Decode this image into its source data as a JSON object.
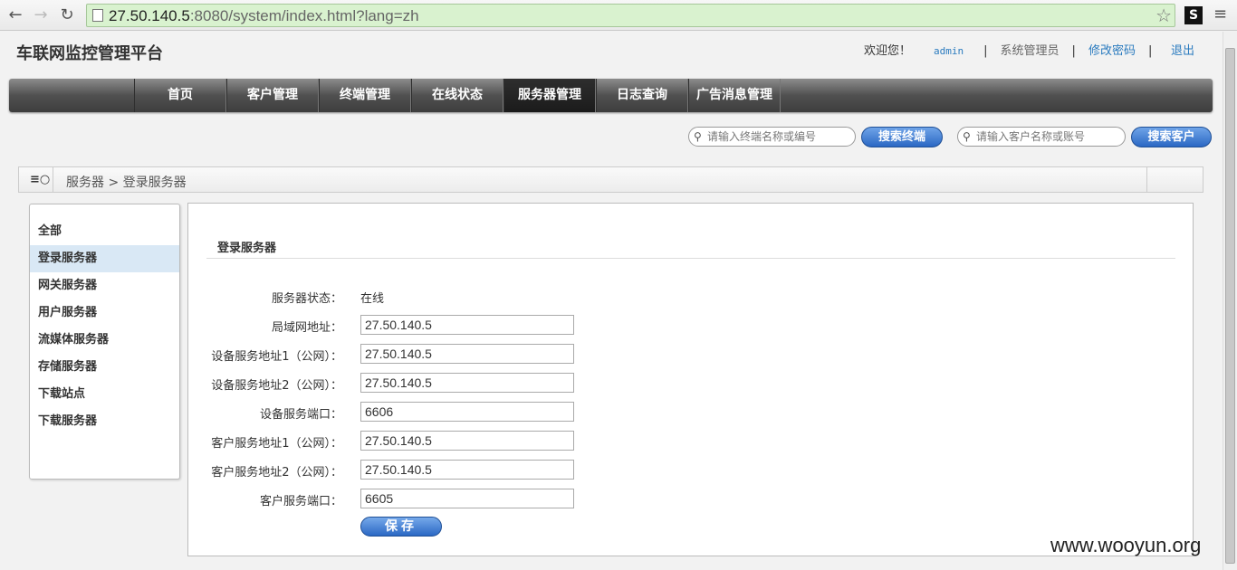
{
  "browser": {
    "url_host": "27.50.140.5",
    "url_rest": ":8080/system/index.html?lang=zh",
    "extension_label": "S"
  },
  "header": {
    "brand": "车联网监控管理平台",
    "welcome": "欢迎您！",
    "username": "admin",
    "sep": "|",
    "role": "系统管理员",
    "change_password": "修改密码",
    "logout": "退出"
  },
  "nav": {
    "tabs": [
      {
        "label": "首页"
      },
      {
        "label": "客户管理"
      },
      {
        "label": "终端管理"
      },
      {
        "label": "在线状态"
      },
      {
        "label": "服务器管理"
      },
      {
        "label": "日志查询"
      },
      {
        "label": "广告消息管理"
      }
    ],
    "active": "服务器管理"
  },
  "search": {
    "terminal_placeholder": "请输入终端名称或编号",
    "terminal_button": "搜索终端",
    "customer_placeholder": "请输入客户名称或账号",
    "customer_button": "搜索客户"
  },
  "breadcrumb": {
    "text": "服务器 > 登录服务器"
  },
  "sidebar": {
    "items": [
      {
        "label": "全部"
      },
      {
        "label": "登录服务器"
      },
      {
        "label": "网关服务器"
      },
      {
        "label": "用户服务器"
      },
      {
        "label": "流媒体服务器"
      },
      {
        "label": "存储服务器"
      },
      {
        "label": "下载站点"
      },
      {
        "label": "下载服务器"
      }
    ],
    "active": "登录服务器"
  },
  "form": {
    "title": "登录服务器",
    "status_label": "服务器状态：",
    "status_value": "在线",
    "fields": [
      {
        "label": "局域网地址：",
        "value": "27.50.140.5"
      },
      {
        "label": "设备服务地址1（公网）：",
        "value": "27.50.140.5"
      },
      {
        "label": "设备服务地址2（公网）：",
        "value": "27.50.140.5"
      },
      {
        "label": "设备服务端口：",
        "value": "6606"
      },
      {
        "label": "客户服务地址1（公网）：",
        "value": "27.50.140.5"
      },
      {
        "label": "客户服务地址2（公网）：",
        "value": "27.50.140.5"
      },
      {
        "label": "客户服务端口：",
        "value": "6605"
      }
    ],
    "save_label": "保存"
  },
  "watermark": "www.wooyun.org"
}
